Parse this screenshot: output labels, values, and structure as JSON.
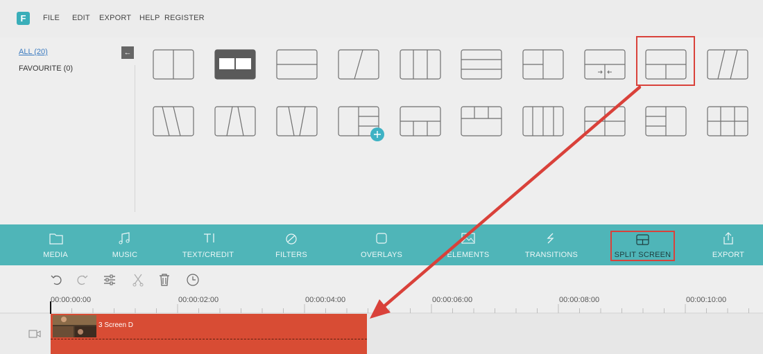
{
  "app": {
    "logo_letter": "F",
    "menu": [
      "FILE",
      "EDIT",
      "EXPORT",
      "HELP",
      "REGISTER"
    ]
  },
  "sidebar": {
    "all_label": "ALL (20)",
    "favourite_label": "FAVOURITE (0)",
    "collapse_icon": "arrow-left-icon"
  },
  "templates": {
    "rows": [
      [
        "vertical-2",
        "selected-2",
        "horizontal-2",
        "diagonal-2",
        "vertical-3",
        "horizontal-3",
        "t-left",
        "split-adjust",
        "top-bottom-split",
        "diagonal-3"
      ],
      [
        "slant-3a",
        "slant-3b",
        "slant-3c",
        "grid-left-add",
        "bottom-3",
        "top-3",
        "vertical-4",
        "grid-4",
        "left-stack",
        "grid-6"
      ]
    ],
    "highlighted": "top-bottom-split"
  },
  "toolbar": {
    "tabs": [
      {
        "label": "MEDIA",
        "icon": "folder-icon"
      },
      {
        "label": "MUSIC",
        "icon": "music-note-icon"
      },
      {
        "label": "TEXT/CREDIT",
        "icon": "text-icon"
      },
      {
        "label": "FILTERS",
        "icon": "filter-icon"
      },
      {
        "label": "OVERLAYS",
        "icon": "overlay-icon"
      },
      {
        "label": "ELEMENTS",
        "icon": "image-icon"
      },
      {
        "label": "TRANSITIONS",
        "icon": "transition-icon"
      },
      {
        "label": "SPLIT SCREEN",
        "icon": "split-screen-icon"
      },
      {
        "label": "EXPORT",
        "icon": "share-icon"
      }
    ],
    "active": "SPLIT SCREEN"
  },
  "edit_tools": [
    "undo-icon",
    "redo-icon",
    "adjust-icon",
    "cut-icon",
    "delete-icon",
    "duration-icon"
  ],
  "timeline": {
    "timecodes": [
      "00:00:00:00",
      "00:00:02:00",
      "00:00:04:00",
      "00:00:06:00",
      "00:00:08:00",
      "00:00:10:00"
    ],
    "clip": {
      "name": "3 Screen D",
      "color": "#d84c34"
    }
  },
  "colors": {
    "accent": "#4fb5b8",
    "highlight": "#d9413a",
    "logo": "#3aaeb9"
  }
}
